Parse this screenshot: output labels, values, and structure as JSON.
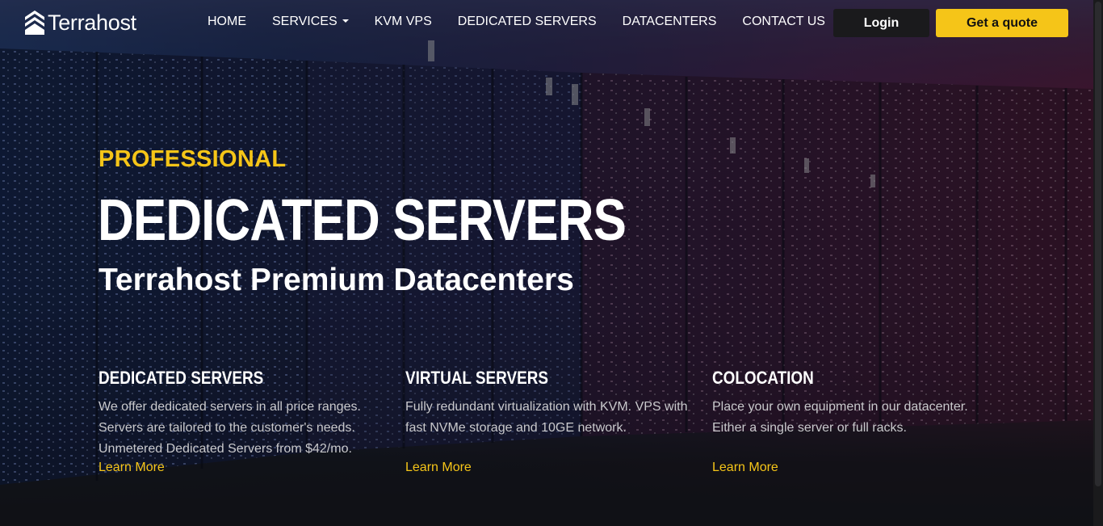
{
  "brand": {
    "name": "Terrahost"
  },
  "nav": {
    "items": [
      {
        "label": "HOME"
      },
      {
        "label": "SERVICES"
      },
      {
        "label": "KVM VPS"
      },
      {
        "label": "DEDICATED SERVERS"
      },
      {
        "label": "DATACENTERS"
      },
      {
        "label": "CONTACT US"
      }
    ],
    "login_label": "Login",
    "quote_label": "Get a quote"
  },
  "hero": {
    "eyebrow": "PROFESSIONAL",
    "headline": "DEDICATED SERVERS",
    "subhead": "Terrahost Premium Datacenters"
  },
  "features": [
    {
      "title": "DEDICATED SERVERS",
      "desc": "We offer dedicated servers in all price ranges. Servers are tailored to the customer's needs. Unmetered Dedicated Servers from $42/mo.",
      "link": "Learn More"
    },
    {
      "title": "VIRTUAL SERVERS",
      "desc": "Fully redundant virtualization with KVM. VPS with fast NVMe storage and 10GE network.",
      "link": "Learn More"
    },
    {
      "title": "COLOCATION",
      "desc": "Place your own equipment in our datacenter. Either a single server or full racks.",
      "link": "Learn More"
    }
  ],
  "colors": {
    "accent": "#f5c518",
    "background": "#141416",
    "button_dark": "#1a1a1c"
  }
}
